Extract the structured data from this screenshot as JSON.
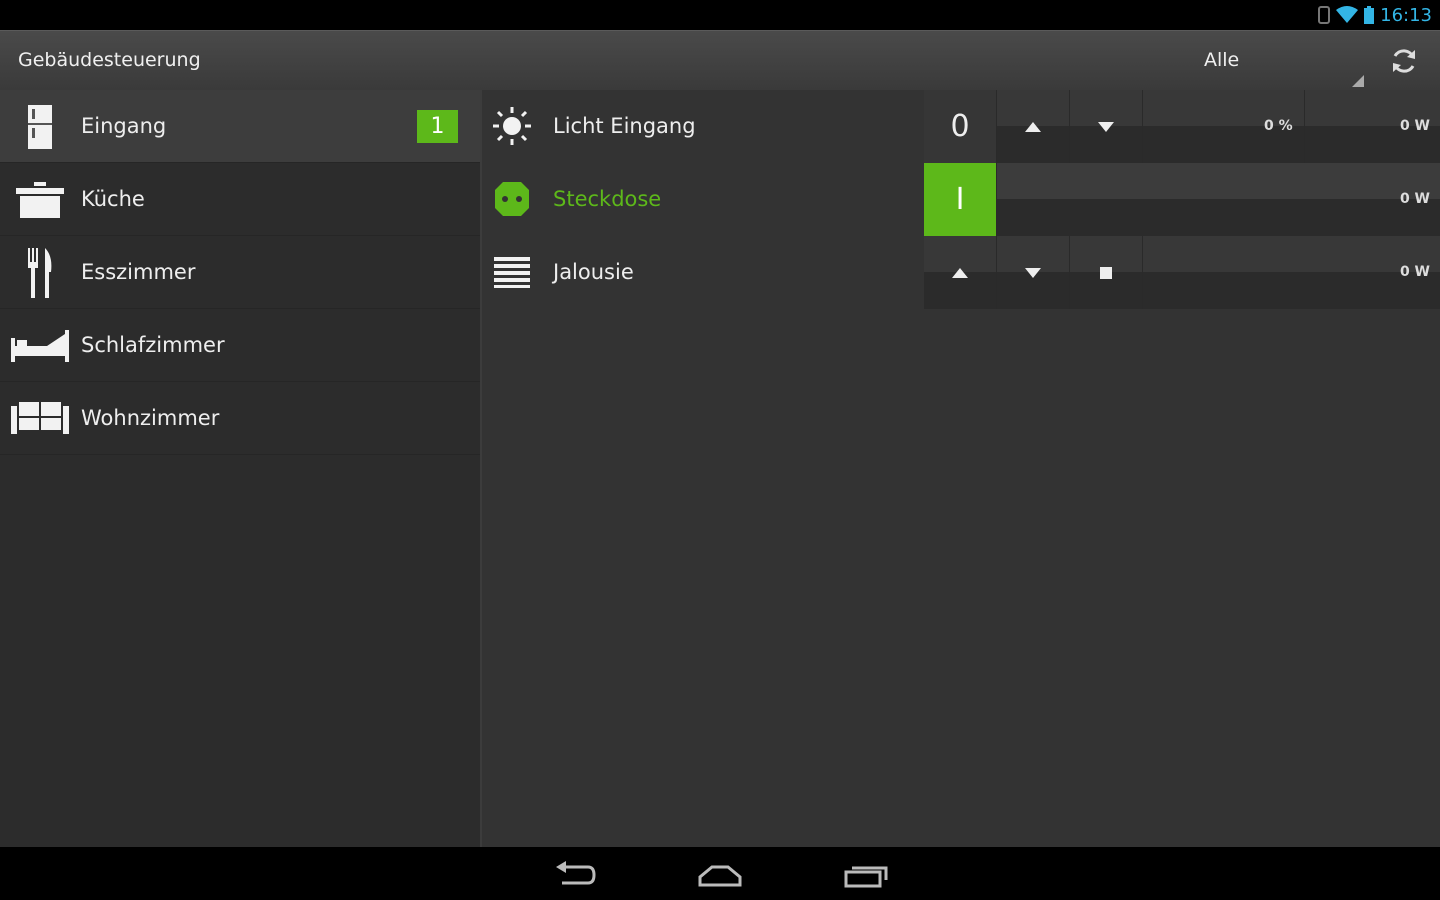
{
  "statusbar": {
    "time": "16:13",
    "icons": [
      "notification-icon",
      "wifi-icon",
      "battery-icon"
    ]
  },
  "actionbar": {
    "title": "Gebäudesteuerung",
    "filter_label": "Alle",
    "refresh_icon": "refresh-icon"
  },
  "rooms": [
    {
      "label": "Eingang",
      "icon": "fridge-icon",
      "badge": "1",
      "active": true
    },
    {
      "label": "Küche",
      "icon": "pot-icon"
    },
    {
      "label": "Esszimmer",
      "icon": "cutlery-icon"
    },
    {
      "label": "Schlafzimmer",
      "icon": "bed-icon"
    },
    {
      "label": "Wohnzimmer",
      "icon": "sofa-icon"
    }
  ],
  "devices": [
    {
      "label": "Licht Eingang",
      "icon": "light-icon",
      "value": "0",
      "percent": "0 %",
      "power": "0 W"
    },
    {
      "label": "Steckdose",
      "icon": "socket-icon",
      "switch": "I",
      "power": "0 W",
      "on": true
    },
    {
      "label": "Jalousie",
      "icon": "blinds-icon",
      "power": "0 W"
    }
  ],
  "colors": {
    "accent": "#5db81a",
    "status": "#33b5e5"
  },
  "navbar": {
    "icons": [
      "back-icon",
      "home-icon",
      "recents-icon"
    ]
  }
}
